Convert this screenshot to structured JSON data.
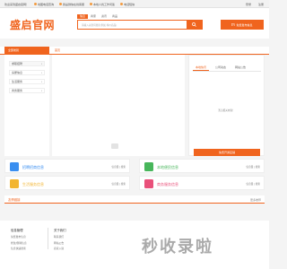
{
  "colors": {
    "accent": "#f0641e",
    "icon_blue": "#3b8ff0",
    "icon_green": "#48b65b",
    "icon_yellow": "#f2b531",
    "icon_pink": "#e9507a"
  },
  "topbar": {
    "links": [
      "欢迎来到盛启官网！",
      "地图电话查询",
      "我是微信在线客服",
      "本地人找工作问答",
      "电话短信"
    ],
    "login": "登录",
    "register": "注册"
  },
  "header": {
    "logo": "盛启官网",
    "search_tabs": [
      "信息",
      "商家",
      "资讯",
      "商品"
    ],
    "search_placeholder": "请输入关键词搜索(例如:特价商品)",
    "search_icon": "search-icon",
    "publish_label": "免费发布信息"
  },
  "nav": {
    "all_categories": "全部类别",
    "home": "首页"
  },
  "left_menu": {
    "items": [
      "求职招聘",
      "房屋信息",
      "生活服务",
      "商务服务"
    ]
  },
  "notice": {
    "tabs": [
      "本地快讯",
      "公司动态",
      "网站公告"
    ],
    "empty_text": "暂无相关内容！",
    "free_button": "免费开通店铺"
  },
  "cards": [
    {
      "title": "招聘招商信息",
      "sub": "信息量 | 搜索"
    },
    {
      "title": "本地便民信息",
      "sub": "信息量 | 搜索"
    },
    {
      "title": "生活服务信息",
      "sub": "信息量 | 搜索"
    },
    {
      "title": "商务服务信息",
      "sub": "信息量 | 搜索"
    }
  ],
  "section": {
    "title": "友情链接",
    "more": "更多推荐"
  },
  "footer": {
    "col1": {
      "title": "信息管理",
      "links": [
        "免费发布信息",
        "修改/删除信息",
        "信息快速搜索"
      ]
    },
    "col2": {
      "title": "关于我们",
      "links": [
        "联系我们",
        "网站公告",
        "商家入驻"
      ]
    }
  },
  "watermark": "秒收录啦"
}
